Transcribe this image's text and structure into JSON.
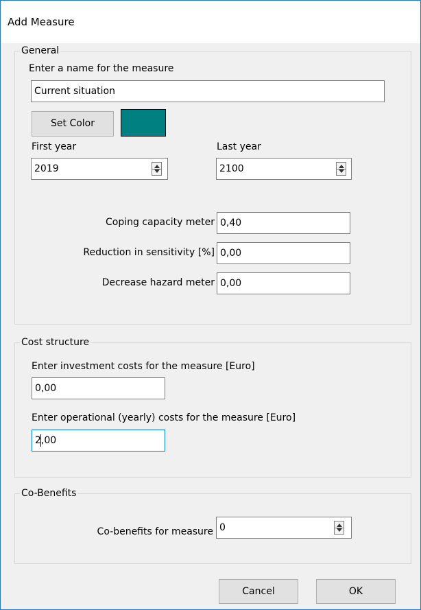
{
  "window": {
    "title": "Add Measure"
  },
  "general": {
    "legend": "General",
    "name_label": "Enter a name for the measure",
    "name_value": "Current situation",
    "set_color_label": "Set Color",
    "color_hex": "#008080",
    "first_year_label": "First year",
    "first_year_value": "2019",
    "last_year_label": "Last year",
    "last_year_value": "2100",
    "coping_label": "Coping capacity meter",
    "coping_value": "0,40",
    "reduction_label": "Reduction in sensitivity  [%]",
    "reduction_value": "0,00",
    "decrease_label": "Decrease hazard meter",
    "decrease_value": "0,00"
  },
  "cost": {
    "legend": "Cost structure",
    "investment_label": "Enter investment costs for the measure [Euro]",
    "investment_value": "0,00",
    "operational_label": "Enter operational (yearly) costs for the measure [Euro]",
    "operational_value": "2,00"
  },
  "cobenefits": {
    "legend": "Co-Benefits",
    "label": "Co-benefits for measure",
    "value": "0"
  },
  "buttons": {
    "cancel": "Cancel",
    "ok": "OK"
  }
}
